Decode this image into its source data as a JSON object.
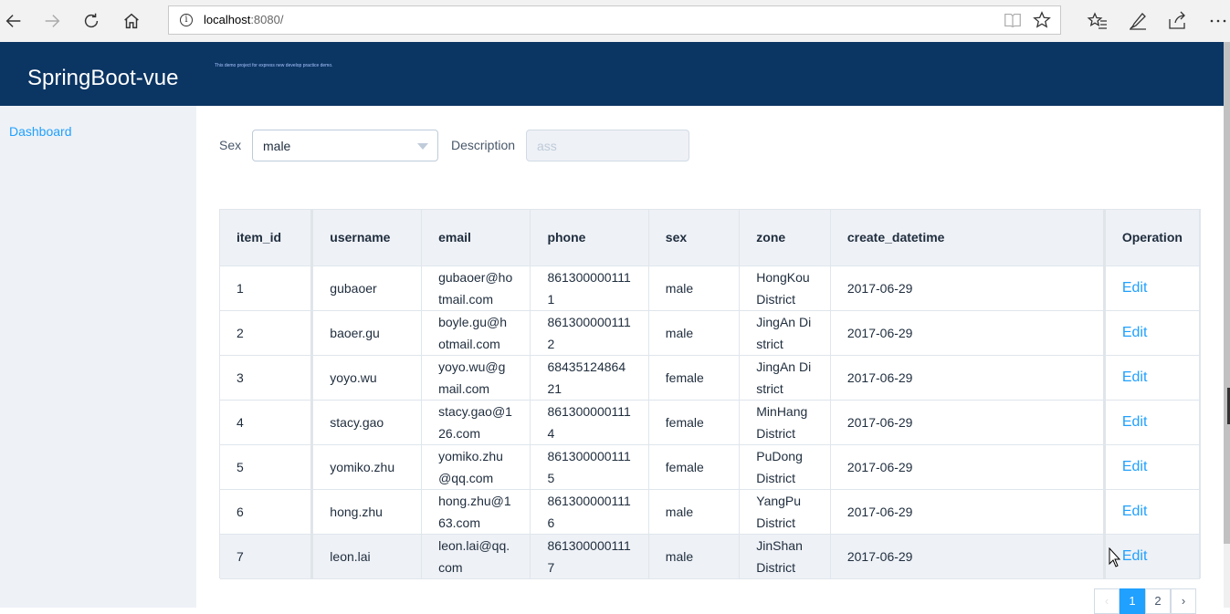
{
  "browser": {
    "url_host": "localhost",
    "url_rest": ":8080/"
  },
  "app": {
    "title": "SpringBoot-vue",
    "subtitle": "This demo project for express new develop practice demo."
  },
  "sidebar": {
    "items": [
      {
        "label": "Dashboard"
      }
    ]
  },
  "form": {
    "sex_label": "Sex",
    "sex_value": "male",
    "description_label": "Description",
    "description_placeholder": "ass"
  },
  "table": {
    "headers": [
      "item_id",
      "username",
      "email",
      "phone",
      "sex",
      "zone",
      "create_datetime",
      "Operation"
    ],
    "rows": [
      {
        "item_id": "1",
        "username": "gubaoer",
        "email": "gubaoer@hotmail.com",
        "phone": "8613000001111",
        "sex": "male",
        "zone": "HongKou District",
        "create_datetime": "2017-06-29",
        "operation": "Edit"
      },
      {
        "item_id": "2",
        "username": "baoer.gu",
        "email": "boyle.gu@hotmail.com",
        "phone": "8613000001112",
        "sex": "male",
        "zone": "JingAn District",
        "create_datetime": "2017-06-29",
        "operation": "Edit"
      },
      {
        "item_id": "3",
        "username": "yoyo.wu",
        "email": "yoyo.wu@gmail.com",
        "phone": "6843512486421",
        "sex": "female",
        "zone": "JingAn District",
        "create_datetime": "2017-06-29",
        "operation": "Edit"
      },
      {
        "item_id": "4",
        "username": "stacy.gao",
        "email": "stacy.gao@126.com",
        "phone": "8613000001114",
        "sex": "female",
        "zone": "MinHang District",
        "create_datetime": "2017-06-29",
        "operation": "Edit"
      },
      {
        "item_id": "5",
        "username": "yomiko.zhu",
        "email": "yomiko.zhu@qq.com",
        "phone": "8613000001115",
        "sex": "female",
        "zone": "PuDong District",
        "create_datetime": "2017-06-29",
        "operation": "Edit"
      },
      {
        "item_id": "6",
        "username": "hong.zhu",
        "email": "hong.zhu@163.com",
        "phone": "8613000001116",
        "sex": "male",
        "zone": "YangPu District",
        "create_datetime": "2017-06-29",
        "operation": "Edit"
      },
      {
        "item_id": "7",
        "username": "leon.lai",
        "email": "leon.lai@qq.com",
        "phone": "8613000001117",
        "sex": "male",
        "zone": "JinShan District",
        "create_datetime": "2017-06-29",
        "operation": "Edit"
      }
    ]
  },
  "pagination": {
    "pages": [
      "1",
      "2"
    ],
    "current": "1"
  },
  "colors": {
    "header_bg": "#0b3563",
    "accent": "#20a0ff",
    "sidebar_bg": "#eef1f6"
  }
}
